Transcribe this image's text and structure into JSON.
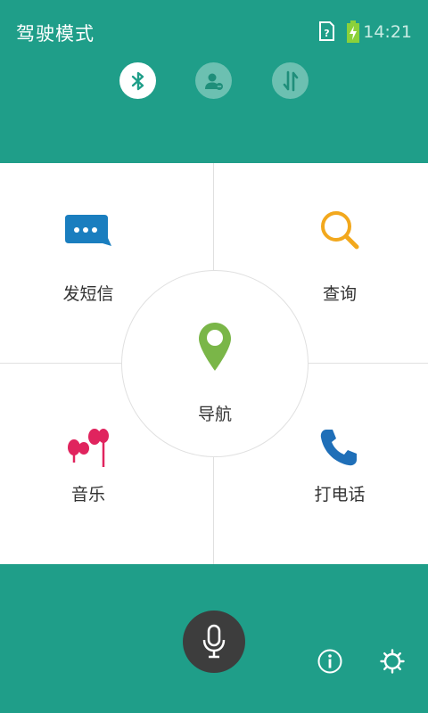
{
  "status_bar": {
    "title": "驾驶模式",
    "time": "14:21",
    "battery_color": "#8bd13a"
  },
  "toggles": [
    {
      "name": "bluetooth",
      "icon": "bluetooth-icon",
      "state": "on"
    },
    {
      "name": "contact",
      "icon": "contact-block-icon",
      "state": "off"
    },
    {
      "name": "data",
      "icon": "data-transfer-icon",
      "state": "off"
    }
  ],
  "grid": {
    "sms": {
      "label": "发短信",
      "icon": "message-bubble-icon",
      "color": "#1a7ebf"
    },
    "search": {
      "label": "查询",
      "icon": "search-icon",
      "color": "#f2a81d"
    },
    "music": {
      "label": "音乐",
      "icon": "earphones-icon",
      "color": "#e0245e"
    },
    "call": {
      "label": "打电话",
      "icon": "phone-icon",
      "color": "#1f6fb8"
    },
    "navigation": {
      "label": "导航",
      "icon": "location-pin-icon",
      "color": "#7ab648"
    }
  },
  "bottom_bar": {
    "mic_icon": "microphone-icon",
    "info_icon": "info-icon",
    "settings_icon": "gear-icon"
  },
  "colors": {
    "accent": "#1f9e89",
    "mic_bg": "#3d3d3d"
  }
}
